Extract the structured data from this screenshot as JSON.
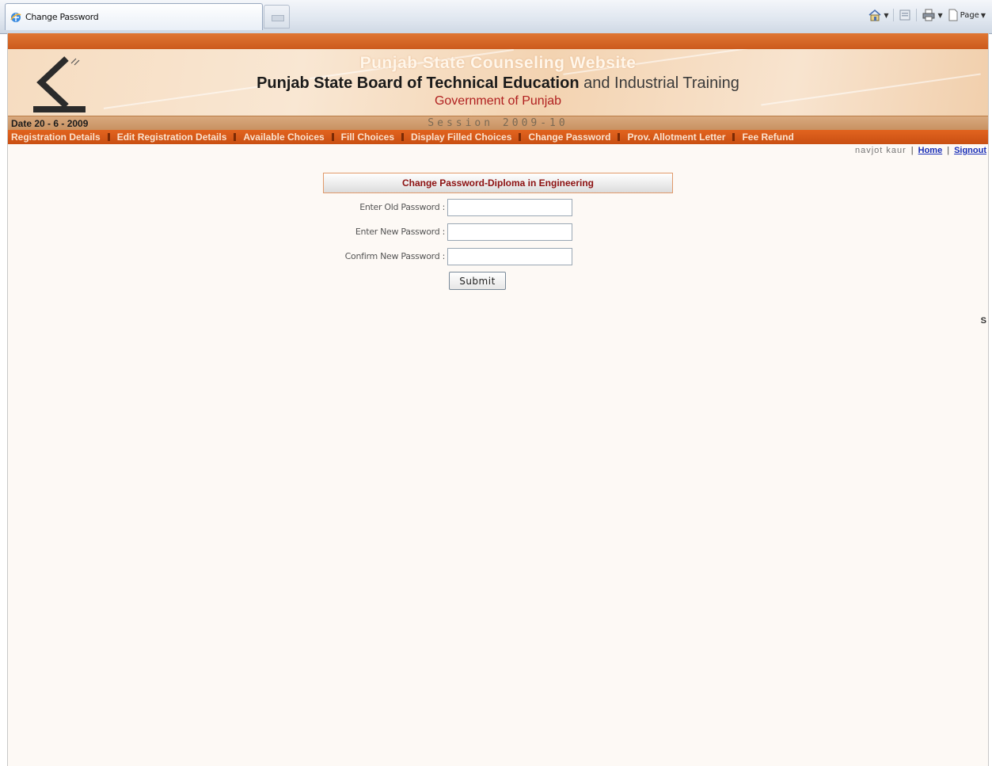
{
  "browser": {
    "tab_title": "Change Password",
    "page_menu_label": "Page"
  },
  "header": {
    "site_title": "Punjab State Counseling Website",
    "board_title_bold": "Punjab State Board of Technical Education",
    "board_title_rest": "and Industrial Training",
    "gov_title": "Government of Punjab",
    "date": "Date  20 - 6 - 2009",
    "session": "Session 2009-10"
  },
  "nav": {
    "items": [
      "Registration Details",
      "Edit Registration Details",
      "Available Choices",
      "Fill Choices",
      "Display Filled Choices",
      "Change Password",
      "Prov. Allotment Letter",
      "Fee Refund"
    ]
  },
  "user": {
    "name": "navjot kaur",
    "home_link": "Home",
    "signout_link": "Signout",
    "separator": "|"
  },
  "form": {
    "heading": "Change Password-Diploma in Engineering",
    "old_label": "Enter Old Password :",
    "new_label": "Enter New Password :",
    "confirm_label": "Confirm New Password :",
    "old_value": "",
    "new_value": "",
    "confirm_value": "",
    "submit_label": "Submit"
  },
  "stray_char": "S",
  "colors": {
    "top_strip": "#d9692b",
    "nav_bar": "#d65a18",
    "heading_text": "#8c1010",
    "gov_text": "#b02020",
    "link": "#1a2fb8"
  }
}
